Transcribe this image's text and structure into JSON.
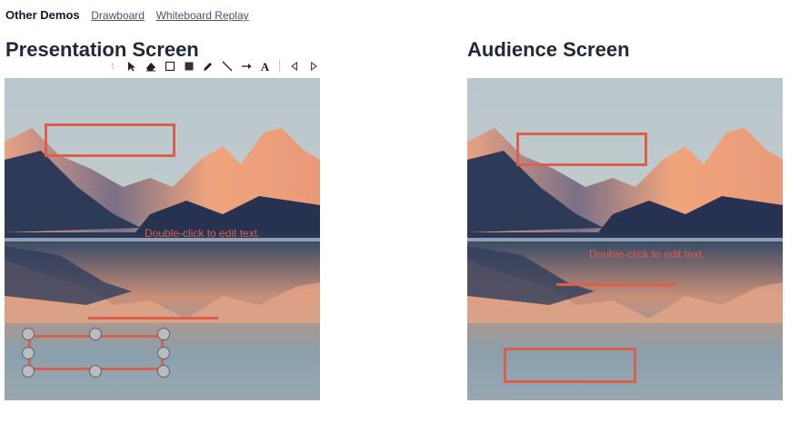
{
  "nav": {
    "brand": "Other Demos",
    "links": [
      "Drawboard",
      "Whiteboard Replay"
    ]
  },
  "presentation": {
    "title": "Presentation Screen",
    "text_annotation": "Double-click to edit text."
  },
  "audience": {
    "title": "Audience Screen",
    "text_annotation": "Double-click to edit text."
  },
  "toolbar": {
    "tools": [
      "drag-handle",
      "select",
      "eraser",
      "rectangle",
      "filled-rectangle",
      "pen",
      "line",
      "arrow",
      "text",
      "undo",
      "redo"
    ],
    "text_tool_label": "A"
  },
  "colors": {
    "annotation": "#d9604a",
    "handle_fill": "#b7bdc3"
  }
}
